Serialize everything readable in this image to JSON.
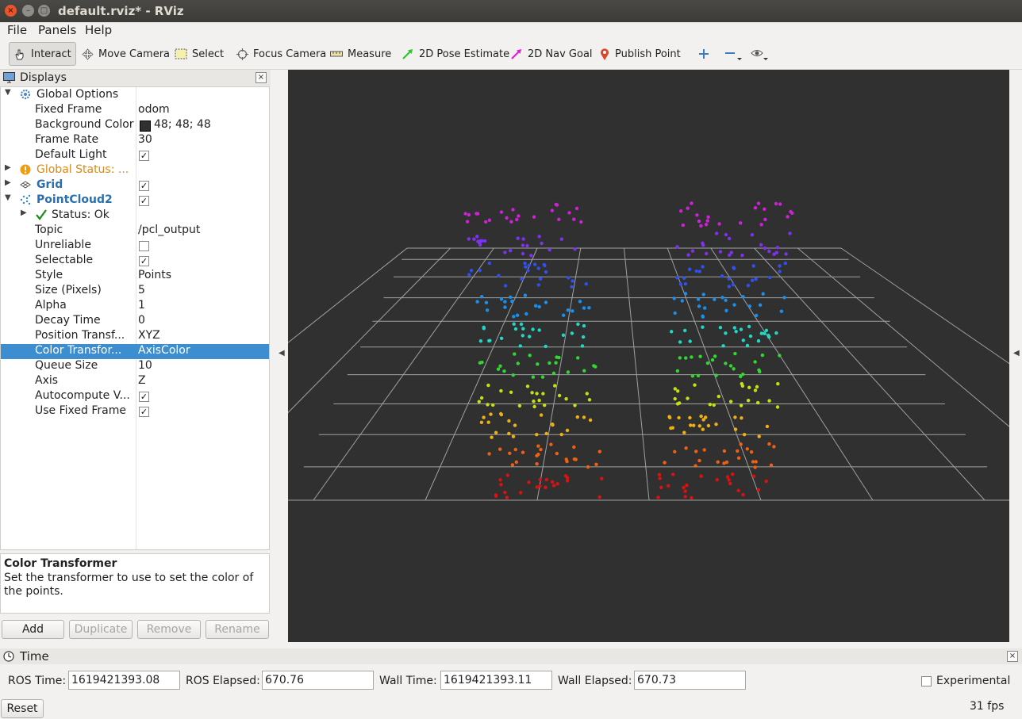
{
  "window": {
    "title": "default.rviz* - RViz",
    "close_glyph": "×",
    "min_glyph": "–",
    "max_glyph": "□"
  },
  "menubar": {
    "items": [
      "File",
      "Panels",
      "Help"
    ]
  },
  "toolbar": {
    "tools": [
      {
        "label": "Interact",
        "icon": "hand-cursor-icon"
      },
      {
        "label": "Move Camera",
        "icon": "move-camera-icon"
      },
      {
        "label": "Select",
        "icon": "select-box-icon"
      },
      {
        "label": "Focus Camera",
        "icon": "focus-camera-icon"
      },
      {
        "label": "Measure",
        "icon": "ruler-icon"
      },
      {
        "label": "2D Pose Estimate",
        "icon": "green-arrow-icon"
      },
      {
        "label": "2D Nav Goal",
        "icon": "magenta-arrow-icon"
      },
      {
        "label": "Publish Point",
        "icon": "map-pin-icon"
      }
    ]
  },
  "displays": {
    "title": "Displays",
    "close_glyph": "×",
    "rows": [
      {
        "name": "Global Options",
        "value": ""
      },
      {
        "name": "Fixed Frame",
        "value": "odom"
      },
      {
        "name": "Background Color",
        "value": "48; 48; 48"
      },
      {
        "name": "Frame Rate",
        "value": "30"
      },
      {
        "name": "Default Light",
        "value": ""
      },
      {
        "name": "Global Status: ...",
        "value": ""
      },
      {
        "name": "Grid",
        "value": ""
      },
      {
        "name": "PointCloud2",
        "value": ""
      },
      {
        "name": "Status: Ok",
        "value": ""
      },
      {
        "name": "Topic",
        "value": "/pcl_output"
      },
      {
        "name": "Unreliable",
        "value": ""
      },
      {
        "name": "Selectable",
        "value": ""
      },
      {
        "name": "Style",
        "value": "Points"
      },
      {
        "name": "Size (Pixels)",
        "value": "5"
      },
      {
        "name": "Alpha",
        "value": "1"
      },
      {
        "name": "Decay Time",
        "value": "0"
      },
      {
        "name": "Position Transf...",
        "value": "XYZ"
      },
      {
        "name": "Color Transfor...",
        "value": "AxisColor"
      },
      {
        "name": "Queue Size",
        "value": "10"
      },
      {
        "name": "Axis",
        "value": "Z"
      },
      {
        "name": "Autocompute V...",
        "value": ""
      },
      {
        "name": "Use Fixed Frame",
        "value": ""
      }
    ],
    "check_glyph": "✓",
    "background_color_swatch": "#303030",
    "description": {
      "title": "Color Transformer",
      "text": "Set the transformer to use to set the color of the points."
    },
    "buttons": [
      "Add",
      "Duplicate",
      "Remove",
      "Rename"
    ]
  },
  "viewport": {
    "background": "#303030"
  },
  "time": {
    "title": "Time",
    "close_glyph": "×",
    "ros_time_label": "ROS Time:",
    "ros_time": "1619421393.08",
    "ros_elapsed_label": "ROS Elapsed:",
    "ros_elapsed": "670.76",
    "wall_time_label": "Wall Time:",
    "wall_time": "1619421393.11",
    "wall_elapsed_label": "Wall Elapsed:",
    "wall_elapsed": "670.73",
    "experimental_label": "Experimental",
    "reset_label": "Reset",
    "fps": "31 fps"
  }
}
